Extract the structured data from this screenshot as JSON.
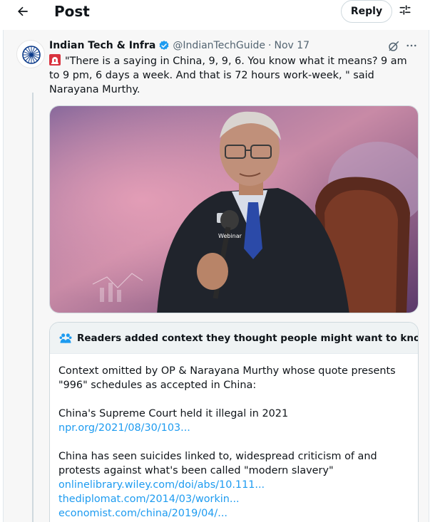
{
  "header": {
    "title": "Post",
    "reply_label": "Reply"
  },
  "icons": {
    "back": "arrow-left-icon",
    "filter": "sliders-icon",
    "verified": "verified-badge-icon",
    "grok": "grok-icon",
    "more": "more-icon",
    "siren": "siren-icon",
    "readers": "people-icon"
  },
  "colors": {
    "accent": "#1d9bf0",
    "verified": "#1d9bf0",
    "secondary_text": "#536471"
  },
  "tweet": {
    "author_name": "Indian Tech & Infra",
    "handle": "@IndianTechGuide",
    "separator": "·",
    "date": "Nov 17",
    "text": "\"There is a saying in China, 9, 9, 6. You know what it means? 9 am to 9 pm, 6 days a week. And that is 72 hours work-week, \" said Narayana Murthy.",
    "media_logo": "Webinar"
  },
  "community_note": {
    "header": "Readers added context they thought people might want to know",
    "paragraph1": "Context omitted by OP & Narayana Murthy whose quote presents \"996\" schedules as accepted in China:",
    "paragraph2": "China's Supreme Court held it illegal in 2021",
    "link1": "npr.org/2021/08/30/103...",
    "paragraph3": "China has seen suicides linked to, widespread criticism of and protests against what's been called \"modern slavery\"",
    "link2": "onlinelibrary.wiley.com/doi/abs/10.111...",
    "link3": "thediplomat.com/2014/03/workin...",
    "link4": "economist.com/china/2019/04/..."
  }
}
